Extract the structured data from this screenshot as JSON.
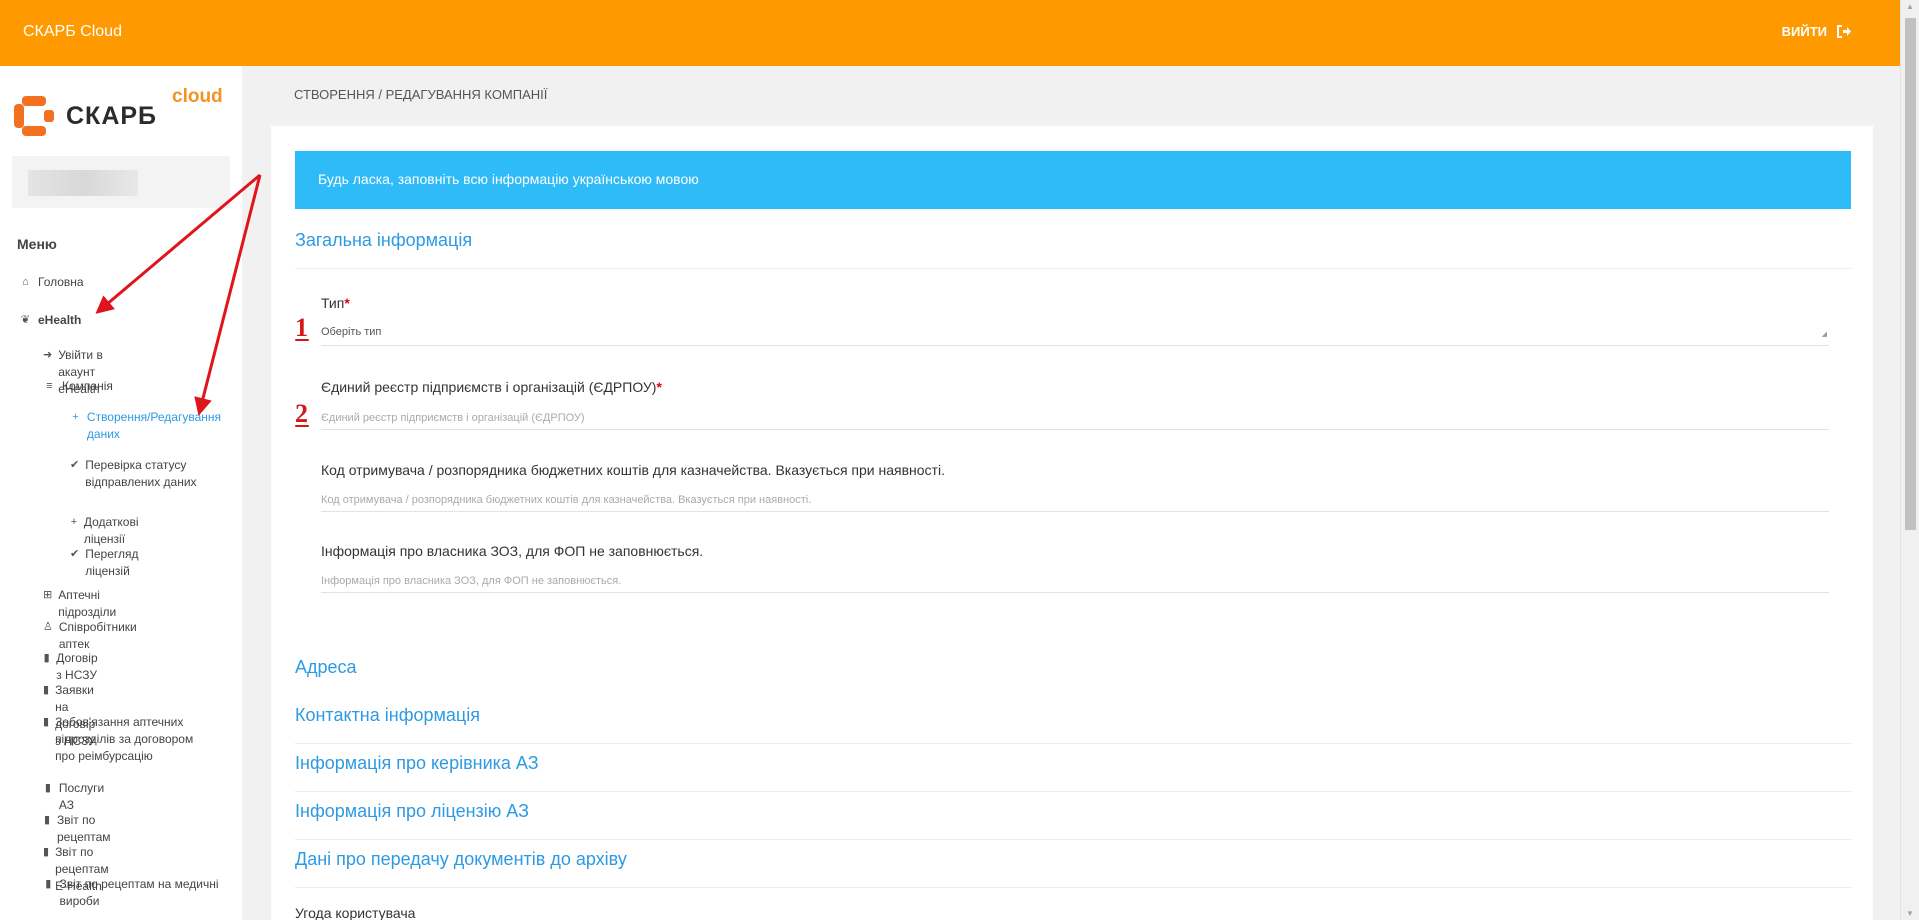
{
  "topbar": {
    "title": "СКАРБ Cloud",
    "logout_label": "ВИЙТИ",
    "logout_icon": "sign-out-icon",
    "color": "#ff9900"
  },
  "sidebar": {
    "logo": {
      "word": "СКАРБ",
      "cloud": "cloud"
    },
    "menu_title": "Меню",
    "items": [
      {
        "label": "Головна",
        "icon": "home-icon"
      },
      {
        "label": "eHealth",
        "icon": "leaf-icon"
      },
      {
        "label": "Увійти в акаунт eHealth",
        "icon": "sign-in-icon"
      },
      {
        "label": "Компанія",
        "icon": "database-icon"
      },
      {
        "label": "Створення/Редагування даних",
        "icon": "plus-icon"
      },
      {
        "label": "Перевірка статусу відправлених даних",
        "icon": "check-icon"
      },
      {
        "label": "Додаткові ліцензії",
        "icon": "plus-icon"
      },
      {
        "label": "Перегляд ліцензій",
        "icon": "check-icon"
      },
      {
        "label": "Аптечні підрозділи",
        "icon": "plus-square-icon"
      },
      {
        "label": "Співробітники аптек",
        "icon": "user-md-icon"
      },
      {
        "label": "Договір з НСЗУ",
        "icon": "file-icon"
      },
      {
        "label": "Заявки на договір з НСЗУ",
        "icon": "file-icon"
      },
      {
        "label": "Зобов'язання аптечних підрозділів за договором про реімбурсацію",
        "icon": "file-icon"
      },
      {
        "label": "Послуги АЗ",
        "icon": "file-icon"
      },
      {
        "label": "Звіт по рецептам",
        "icon": "file-icon"
      },
      {
        "label": "Звіт по рецептам E-Health",
        "icon": "file-icon"
      },
      {
        "label": "Звіт по рецептам на медичні вироби",
        "icon": "file-icon"
      }
    ]
  },
  "breadcrumb": "СТВОРЕННЯ / РЕДАГУВАННЯ КОМПАНІЇ",
  "alert": "Будь ласка, заповніть всю інформацію українською мовою",
  "sections": {
    "general": "Загальна інформація",
    "address": "Адреса",
    "contact": "Контактна інформація",
    "head": "Інформація про керівника АЗ",
    "license": "Інформація про ліцензію АЗ",
    "archive": "Дані про передачу документів до архіву"
  },
  "form": {
    "type": {
      "label": "Тип",
      "required": "*",
      "value": "Оберіть тип"
    },
    "edrpou": {
      "label": "Єдиний реєстр підприємств і організацій (ЄДРПОУ)",
      "required": "*",
      "placeholder": "Єдиний реєстр підприємств і організацій (ЄДРПОУ)"
    },
    "treasury": {
      "label": "Код отримувача / розпорядника бюджетних коштів для казначейства. Вказується при наявності.",
      "placeholder": "Код отримувача / розпорядника бюджетних коштів для казначейства. Вказується при наявності."
    },
    "owner": {
      "label": "Інформація про власника ЗОЗ, для ФОП не заповнюється.",
      "placeholder": "Інформація про власника ЗОЗ, для ФОП не заповнюється."
    }
  },
  "annotations": {
    "one": "1",
    "two": "2",
    "arrow_color": "#e0141b"
  },
  "agreement": "Угода користувача"
}
